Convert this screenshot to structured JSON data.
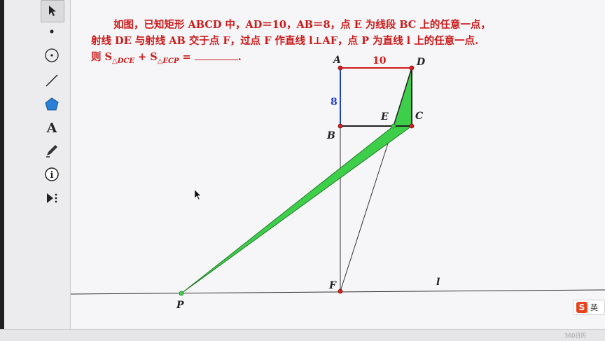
{
  "toolbar": {
    "tools": [
      {
        "name": "select-arrow-icon"
      },
      {
        "name": "point-icon"
      },
      {
        "name": "compass-circle-icon"
      },
      {
        "name": "line-segment-icon"
      },
      {
        "name": "polygon-icon"
      },
      {
        "name": "text-tool-icon",
        "glyph": "A"
      },
      {
        "name": "marker-pen-icon"
      },
      {
        "name": "info-icon",
        "glyph": "i"
      },
      {
        "name": "custom-tool-icon"
      }
    ]
  },
  "problem": {
    "line1": "如图，已知矩形 ABCD 中，AD＝10，AB＝8，点 E 为线段 BC 上的任意一点，",
    "line2": "射线 DE 与射线 AB 交于点 F，过点 F 作直线 l⊥AF，点 P 为直线 l 上的任意一点.",
    "line3_prefix": "则 S",
    "sub1": "△DCE",
    "plus": " + S",
    "sub2": "△ECP",
    "equals": " = ",
    "end": "."
  },
  "figure": {
    "labels": {
      "A": "A",
      "B": "B",
      "C": "C",
      "D": "D",
      "E": "E",
      "F": "F",
      "P": "P",
      "l": "l"
    },
    "lengths": {
      "AD": "10",
      "AB": "8"
    },
    "colors": {
      "top_side": "#d11a1a",
      "left_side": "#1f3fcc",
      "fill": "#3ecf4a",
      "point": "#d32020",
      "line": "#222222"
    }
  },
  "ime": {
    "logo": "S",
    "lang": "英"
  },
  "watermark": "360日历"
}
